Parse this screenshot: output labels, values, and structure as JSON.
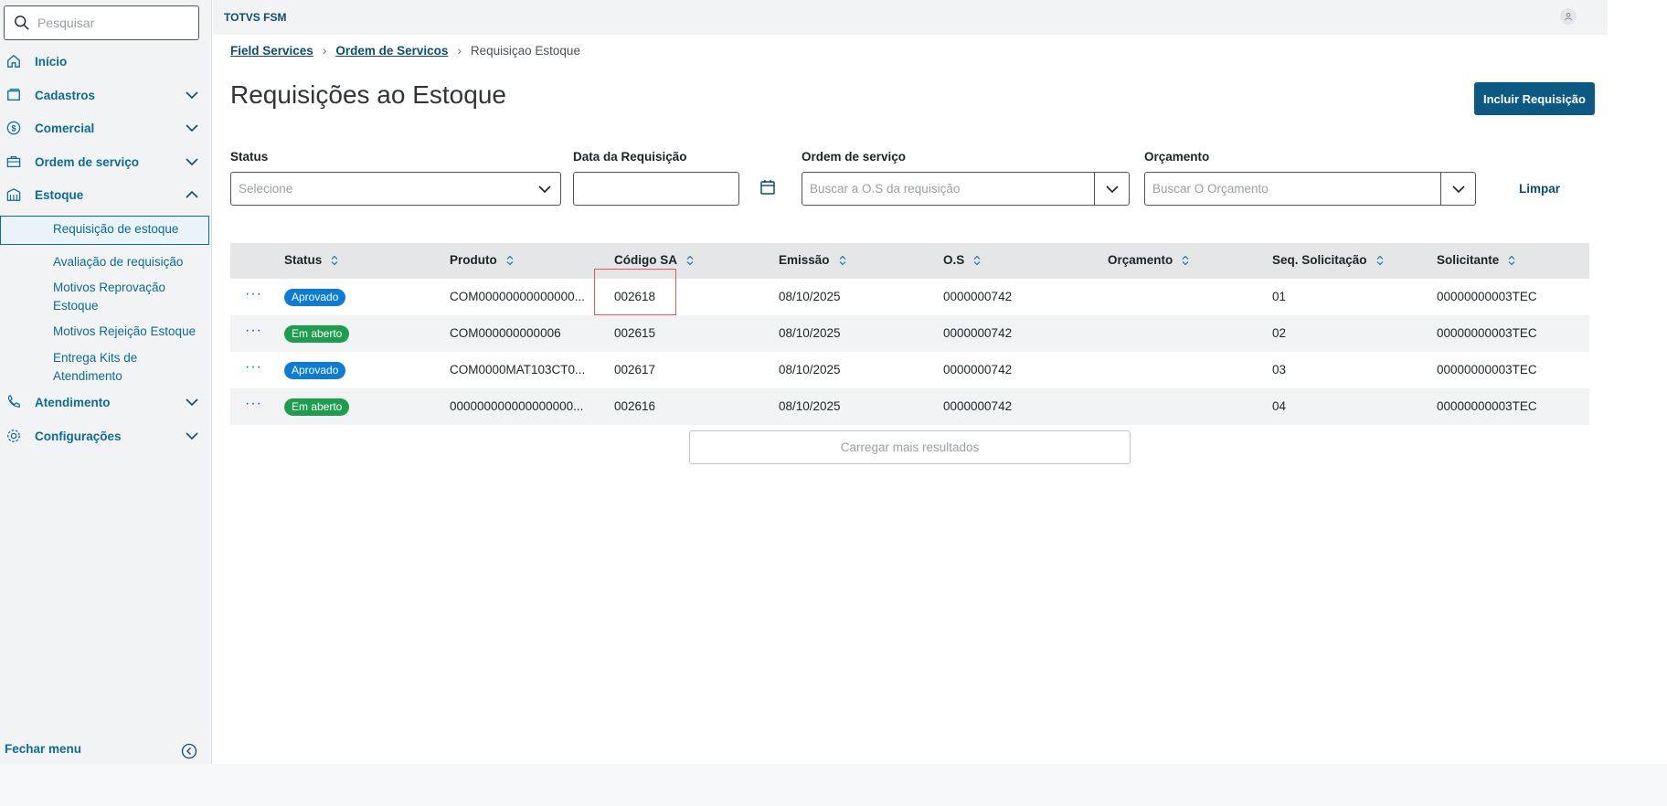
{
  "sidebar": {
    "search_placeholder": "Pesquisar",
    "items": [
      {
        "label": "Início",
        "icon": "home-icon"
      },
      {
        "label": "Cadastros",
        "icon": "card-icon"
      },
      {
        "label": "Comercial",
        "icon": "dollar-icon"
      },
      {
        "label": "Ordem de serviço",
        "icon": "briefcase-icon"
      },
      {
        "label": "Estoque",
        "icon": "warehouse-icon"
      },
      {
        "label": "Atendimento",
        "icon": "phone-icon"
      },
      {
        "label": "Configurações",
        "icon": "gear-icon"
      }
    ],
    "estoque_sub": [
      "Requisição de estoque",
      "Avaliação de requisição",
      "Motivos Reprovação Estoque",
      "Motivos Rejeição Estoque",
      "Entrega Kits de Atendimento"
    ],
    "close_label": "Fechar menu"
  },
  "header": {
    "app_title": "TOTVS FSM"
  },
  "breadcrumb": [
    "Field Services",
    "Ordem de Servicos",
    "Requisiçao Estoque"
  ],
  "page": {
    "title": "Requisições ao Estoque",
    "add_button": "Incluir Requisição"
  },
  "filters": {
    "status_label": "Status",
    "status_placeholder": "Selecione",
    "date_label": "Data da Requisição",
    "os_label": "Ordem de serviço",
    "os_placeholder": "Buscar a O.S da requisição",
    "budget_label": "Orçamento",
    "budget_placeholder": "Buscar O Orçamento",
    "clear_label": "Limpar"
  },
  "table": {
    "columns": [
      "Status",
      "Produto",
      "Código SA",
      "Emissão",
      "O.S",
      "Orçamento",
      "Seq. Solicitação",
      "Solicitante"
    ],
    "rows": [
      {
        "status": "Aprovado",
        "status_color": "#0c7cd5",
        "produto": "COM00000000000000...",
        "codigo": "002618",
        "emissao": "08/10/2025",
        "os": "0000000742",
        "orcamento": "",
        "seq": "01",
        "solicitante": "00000000003TEC"
      },
      {
        "status": "Em aberto",
        "status_color": "#1f9d4f",
        "produto": "COM000000000006",
        "codigo": "002615",
        "emissao": "08/10/2025",
        "os": "0000000742",
        "orcamento": "",
        "seq": "02",
        "solicitante": "00000000003TEC"
      },
      {
        "status": "Aprovado",
        "status_color": "#0c7cd5",
        "produto": "COM0000MAT103CT0...",
        "codigo": "002617",
        "emissao": "08/10/2025",
        "os": "0000000742",
        "orcamento": "",
        "seq": "03",
        "solicitante": "00000000003TEC"
      },
      {
        "status": "Em aberto",
        "status_color": "#1f9d4f",
        "produto": "000000000000000000...",
        "codigo": "002616",
        "emissao": "08/10/2025",
        "os": "0000000742",
        "orcamento": "",
        "seq": "04",
        "solicitante": "00000000003TEC"
      }
    ],
    "row_actions_glyph": "···",
    "load_more": "Carregar mais resultados"
  },
  "colors": {
    "primary": "#0c5a84",
    "link": "#0c6c94",
    "approved": "#0c7cd5",
    "open": "#1f9d4f",
    "highlight": "#e05a5a"
  }
}
